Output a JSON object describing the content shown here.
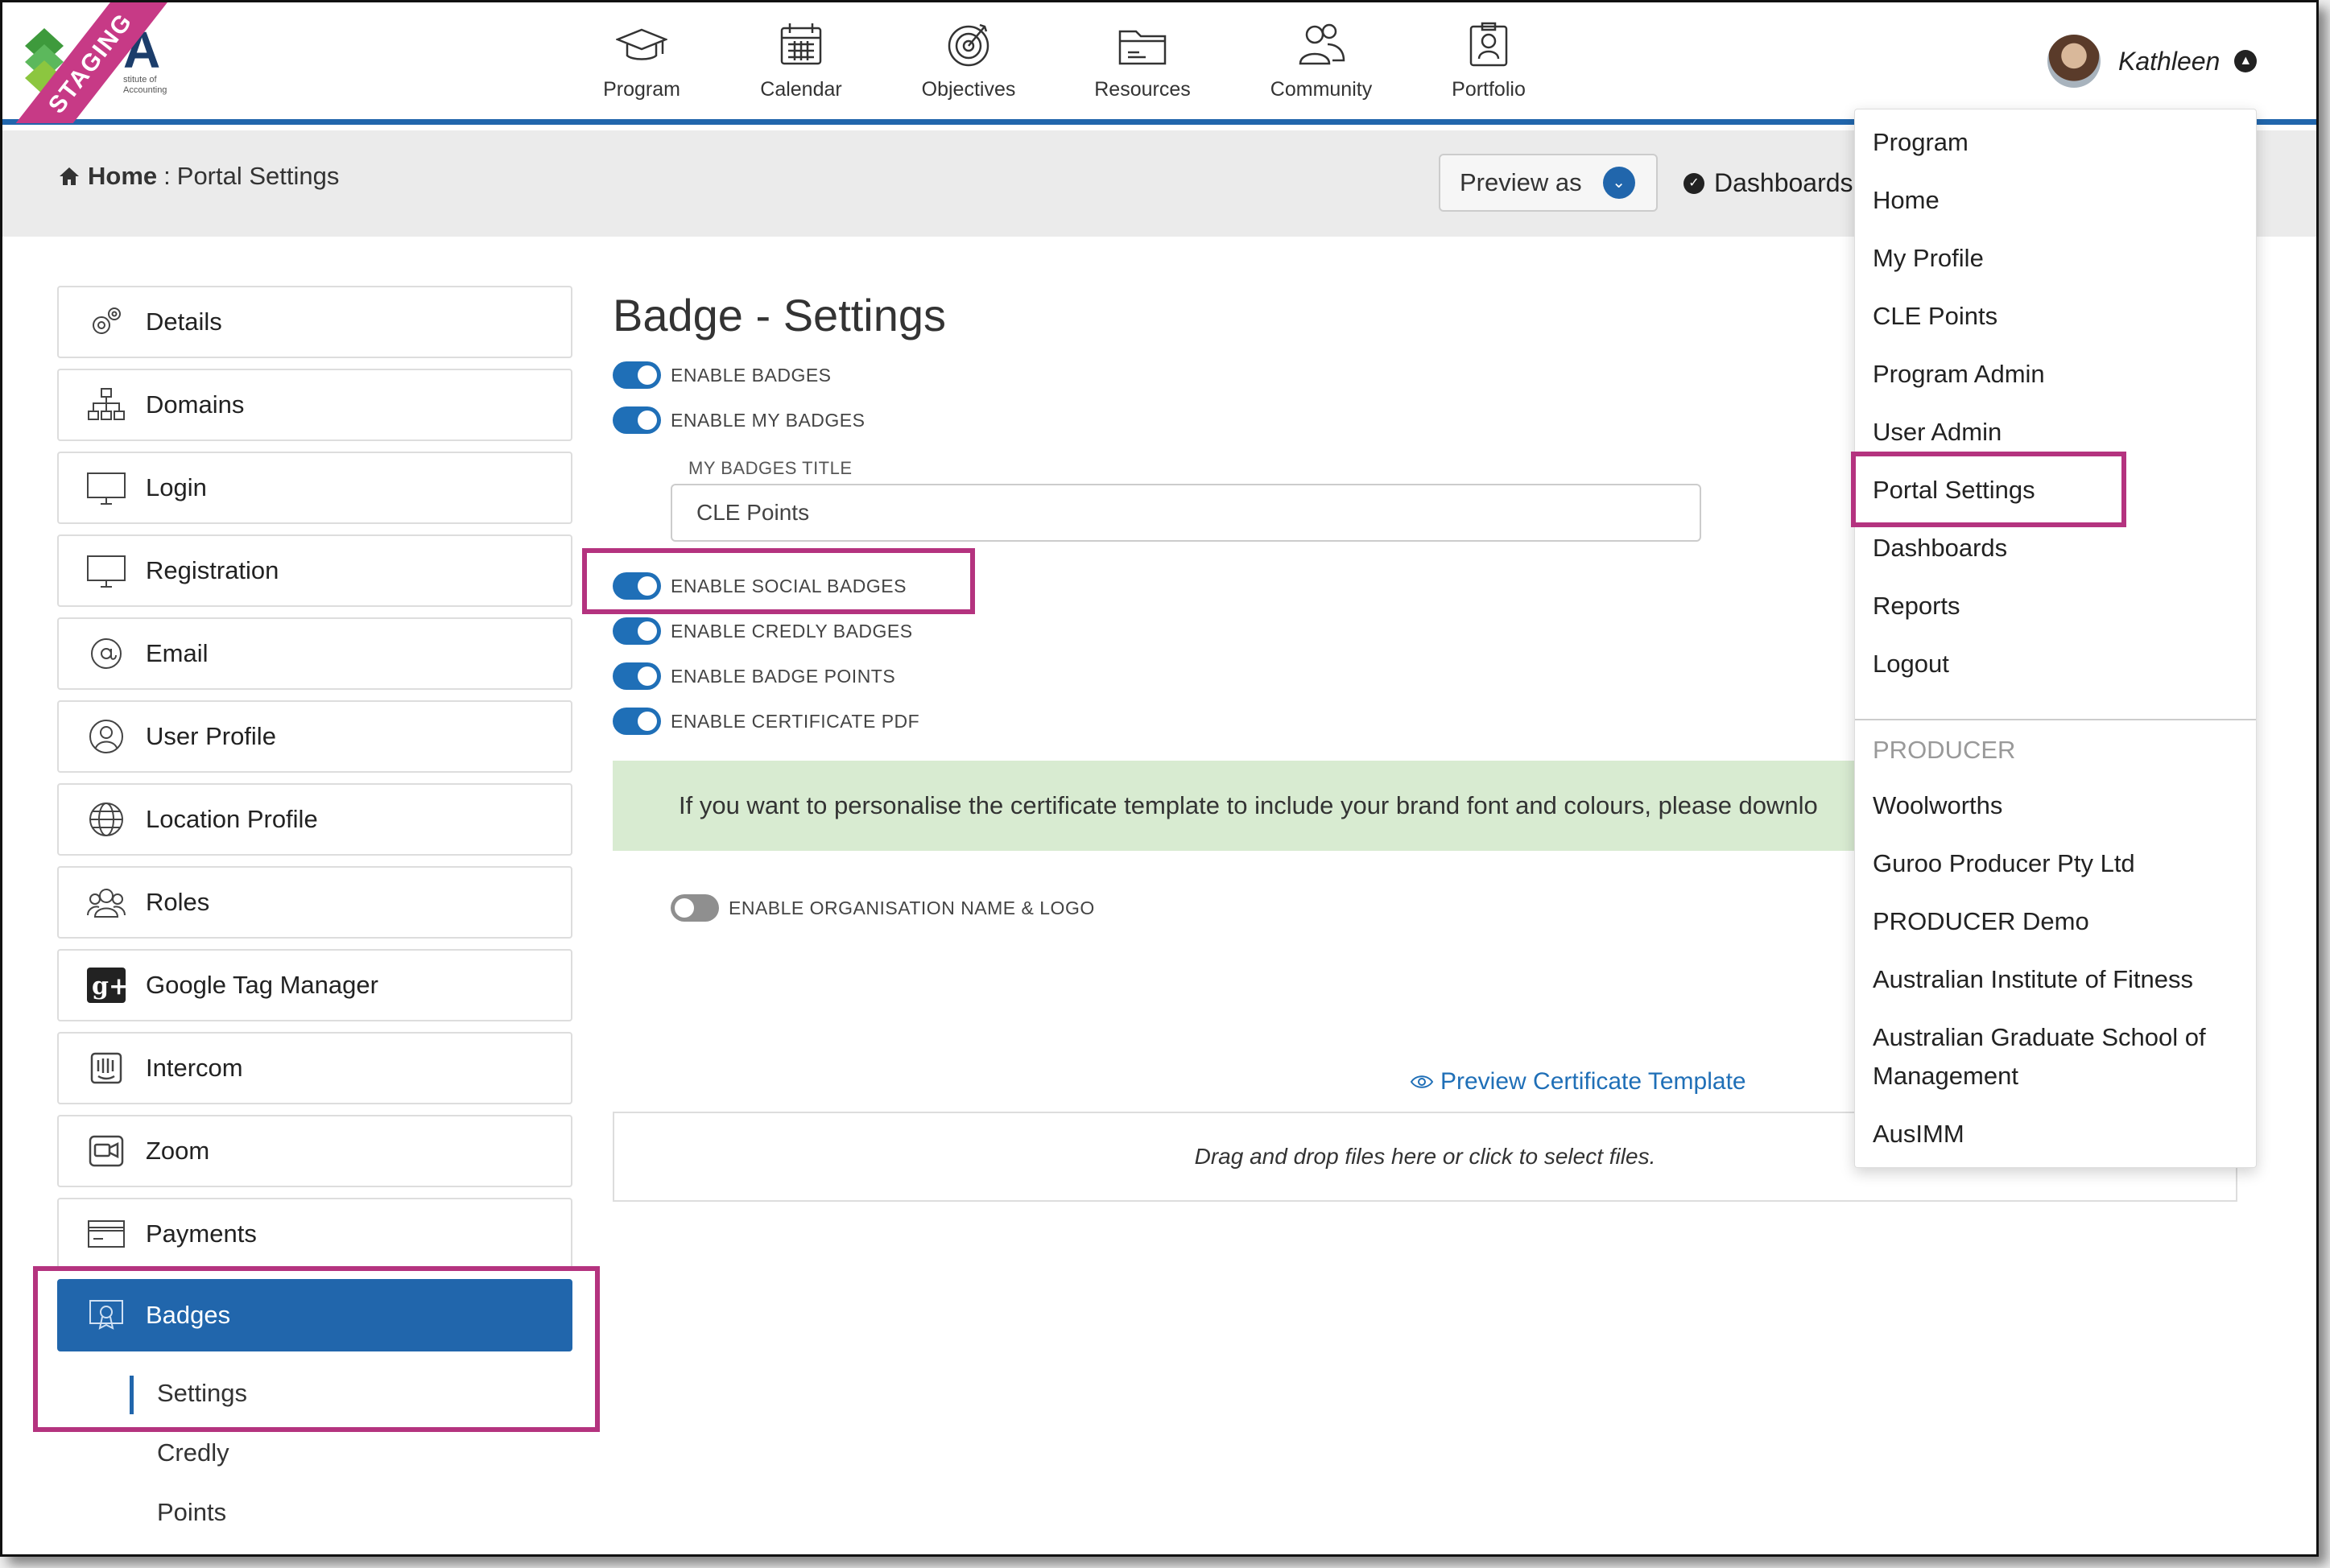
{
  "app": {
    "staging_label": "STAGING",
    "logo_letter": "A",
    "logo_sub": "stitute of\nAccounting"
  },
  "nav": [
    {
      "label": "Program",
      "icon": "graduation-cap-icon"
    },
    {
      "label": "Calendar",
      "icon": "calendar-icon"
    },
    {
      "label": "Objectives",
      "icon": "target-icon"
    },
    {
      "label": "Resources",
      "icon": "folder-icon"
    },
    {
      "label": "Community",
      "icon": "people-icon"
    },
    {
      "label": "Portfolio",
      "icon": "portfolio-icon"
    }
  ],
  "user": {
    "name": "Kathleen"
  },
  "breadcrumb": {
    "home": "Home",
    "separator": ":",
    "current": "Portal Settings"
  },
  "header_actions": {
    "preview_as": "Preview as",
    "dashboards": "Dashboards"
  },
  "sidebar": {
    "items": [
      {
        "label": "Details",
        "icon": "gears-icon"
      },
      {
        "label": "Domains",
        "icon": "sitemap-icon"
      },
      {
        "label": "Login",
        "icon": "monitor-icon"
      },
      {
        "label": "Registration",
        "icon": "monitor-icon"
      },
      {
        "label": "Email",
        "icon": "at-icon"
      },
      {
        "label": "User Profile",
        "icon": "user-circle-icon"
      },
      {
        "label": "Location Profile",
        "icon": "globe-icon"
      },
      {
        "label": "Roles",
        "icon": "users-icon"
      },
      {
        "label": "Google Tag Manager",
        "icon": "google-plus-icon"
      },
      {
        "label": "Intercom",
        "icon": "intercom-icon"
      },
      {
        "label": "Zoom",
        "icon": "video-icon"
      },
      {
        "label": "Payments",
        "icon": "credit-card-icon"
      },
      {
        "label": "Badges",
        "icon": "certificate-icon",
        "active": true
      }
    ],
    "sub_items": [
      "Settings",
      "Credly",
      "Points"
    ]
  },
  "main": {
    "title": "Badge - Settings",
    "toggles": [
      {
        "label": "ENABLE BADGES",
        "on": true
      },
      {
        "label": "ENABLE MY BADGES",
        "on": true
      }
    ],
    "my_badges_title_label": "MY BADGES TITLE",
    "my_badges_title_value": "CLE Points",
    "toggles2": [
      {
        "label": "ENABLE SOCIAL BADGES",
        "on": true
      },
      {
        "label": "ENABLE CREDLY BADGES",
        "on": true
      },
      {
        "label": "ENABLE BADGE POINTS",
        "on": true
      },
      {
        "label": "ENABLE CERTIFICATE PDF",
        "on": true
      }
    ],
    "alert_text": "If you want to personalise the certificate template to include your brand font and colours, please downlo",
    "org_toggle": {
      "label": "ENABLE ORGANISATION NAME & LOGO",
      "on": false
    },
    "preview_certificate": "Preview Certificate Template",
    "dropzone_text": "Drag and drop files here or click to select files."
  },
  "user_menu": {
    "items": [
      "Program",
      "Home",
      "My Profile",
      "CLE Points",
      "Program Admin",
      "User Admin",
      "Portal Settings",
      "Dashboards",
      "Reports",
      "Logout"
    ],
    "producer_heading": "PRODUCER",
    "producers": [
      "Woolworths",
      "Guroo Producer Pty Ltd",
      "PRODUCER Demo",
      "Australian Institute of Fitness",
      "Australian Graduate School of Management",
      "AusIMM"
    ]
  },
  "colors": {
    "accent": "#2166ac",
    "highlight": "#b4337f",
    "staging": "#c73a86",
    "alert_bg": "#d8ebd1"
  }
}
